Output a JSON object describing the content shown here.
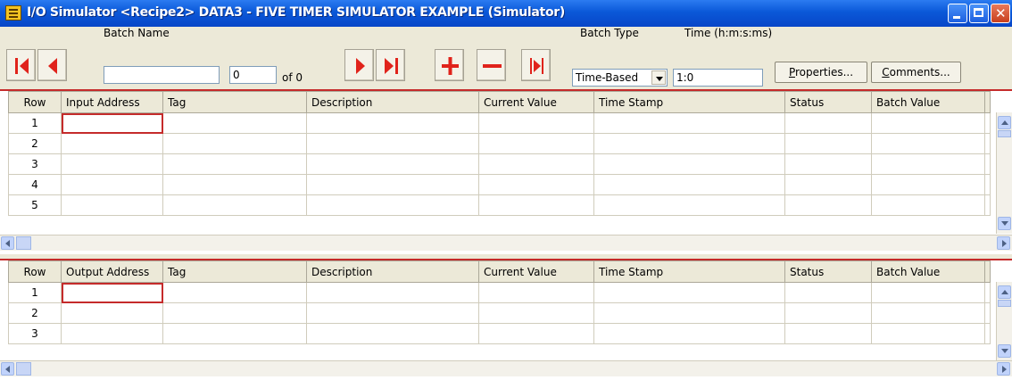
{
  "window": {
    "title": "I/O Simulator <Recipe2> DATA3 - FIVE TIMER SIMULATOR EXAMPLE (Simulator)"
  },
  "toolbar": {
    "batch_name_label": "Batch Name",
    "batch_name_value": "",
    "batch_index": "0",
    "of_label": "of",
    "batch_total": "0",
    "batch_type_label": "Batch Type",
    "batch_type_value": "Time-Based",
    "time_label": "Time (h:m:s:ms)",
    "time_value": "1:0",
    "properties_mnemonic": "P",
    "properties_rest": "roperties...",
    "comments_mnemonic": "C",
    "comments_rest": "omments...",
    "accent_color": "#e0231b"
  },
  "input_grid": {
    "headers": [
      "Row",
      "Input Address",
      "Tag",
      "Description",
      "Current Value",
      "Time Stamp",
      "Status",
      "Batch Value"
    ],
    "rows": [
      "1",
      "2",
      "3",
      "4",
      "5"
    ]
  },
  "output_grid": {
    "headers": [
      "Row",
      "Output Address",
      "Tag",
      "Description",
      "Current Value",
      "Time Stamp",
      "Status",
      "Batch Value"
    ],
    "rows": [
      "1",
      "2",
      "3"
    ]
  }
}
